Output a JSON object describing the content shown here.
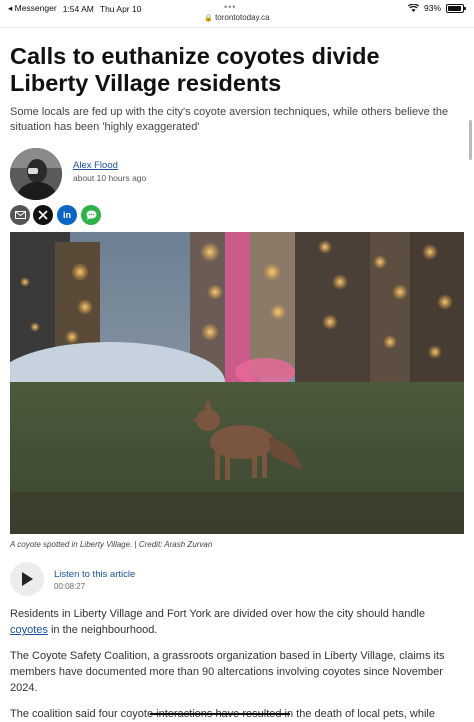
{
  "status_bar": {
    "back_app": "◂ Messenger",
    "time": "1:54 AM",
    "date": "Thu Apr 10",
    "battery": "93%",
    "battery_level": 0.93
  },
  "browser": {
    "url": "torontotoday.ca"
  },
  "article": {
    "headline": "Calls to euthanize coyotes divide Liberty Village residents",
    "subtitle": "Some locals are fed up with the city's coyote aversion techniques, while others believe the situation has been 'highly exaggerated'",
    "author": "Alex Flood",
    "published": "about 10 hours ago",
    "share": {
      "email_icon": "envelope-icon",
      "x_icon": "x-logo-icon",
      "linkedin_label": "in",
      "sms_icon": "chat-bubble-icon"
    },
    "photo_caption": "A coyote spotted in Liberty Village.  |  Credit: Arash Zurvan",
    "audio": {
      "listen_label": "Listen to this article",
      "duration": "00:08:27"
    },
    "paragraphs": {
      "p1_before": "Residents in Liberty Village and Fort York are divided over how the city should handle ",
      "p1_link": "coyotes",
      "p1_after": " in the neighbourhood.",
      "p2": "The Coyote Safety Coalition, a grassroots organization based in Liberty Village, claims its members have documented more than 90 altercations involving coyotes since November 2024.",
      "p3": "The coalition said four coyote interactions have resulted in the death of local pets, while"
    }
  },
  "colors": {
    "link": "#1a4fa0",
    "email_bg": "#555555",
    "x_bg": "#111111",
    "linkedin_bg": "#0a66c2",
    "sms_bg": "#2db34a"
  }
}
